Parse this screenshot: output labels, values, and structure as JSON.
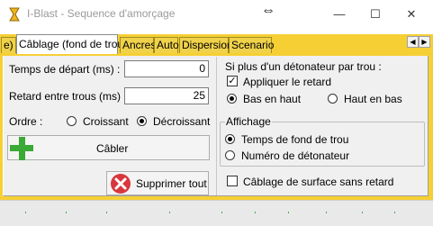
{
  "window": {
    "title": "I-Blast - Sequence d'amorçage",
    "minimize_glyph": "—",
    "maximize_glyph": "☐",
    "close_glyph": "✕",
    "move_glyph": "⇔"
  },
  "tabs": {
    "items": [
      {
        "label": "e)"
      },
      {
        "label": "Câblage (fond de trou)"
      },
      {
        "label": "Ancres"
      },
      {
        "label": "Auto"
      },
      {
        "label": "Dispersion"
      },
      {
        "label": "Scenario"
      }
    ],
    "active_index": 1,
    "scroll_left": "◀",
    "scroll_right": "▶"
  },
  "left": {
    "depart_label": "Temps de départ (ms) :",
    "depart_value": "0",
    "retard_label": "Retard entre trous (ms) :",
    "retard_value": "25",
    "ordre_label": "Ordre :",
    "croissant_label": "Croissant",
    "decroissant_label": "Décroissant",
    "ordre_selected": "Décroissant",
    "cabler_label": "Câbler",
    "supprimer_label": "Supprimer tout"
  },
  "right": {
    "multi_label": "Si plus d'un détonateur par trou :",
    "appliquer_label": "Appliquer le retard",
    "appliquer_checked": true,
    "bas_label": "Bas en haut",
    "haut_label": "Haut en bas",
    "direction_selected": "Bas en haut",
    "affichage_title": "Affichage",
    "temps_label": "Temps de fond de trou",
    "numero_label": "Numéro de détonateur",
    "affichage_selected": "Temps de fond de trou",
    "surface_label": "Câblage de surface sans retard",
    "surface_checked": false
  },
  "colors": {
    "tab_strip": "#f6cf34",
    "add_icon": "#3aa935",
    "delete_icon": "#d9363e"
  }
}
